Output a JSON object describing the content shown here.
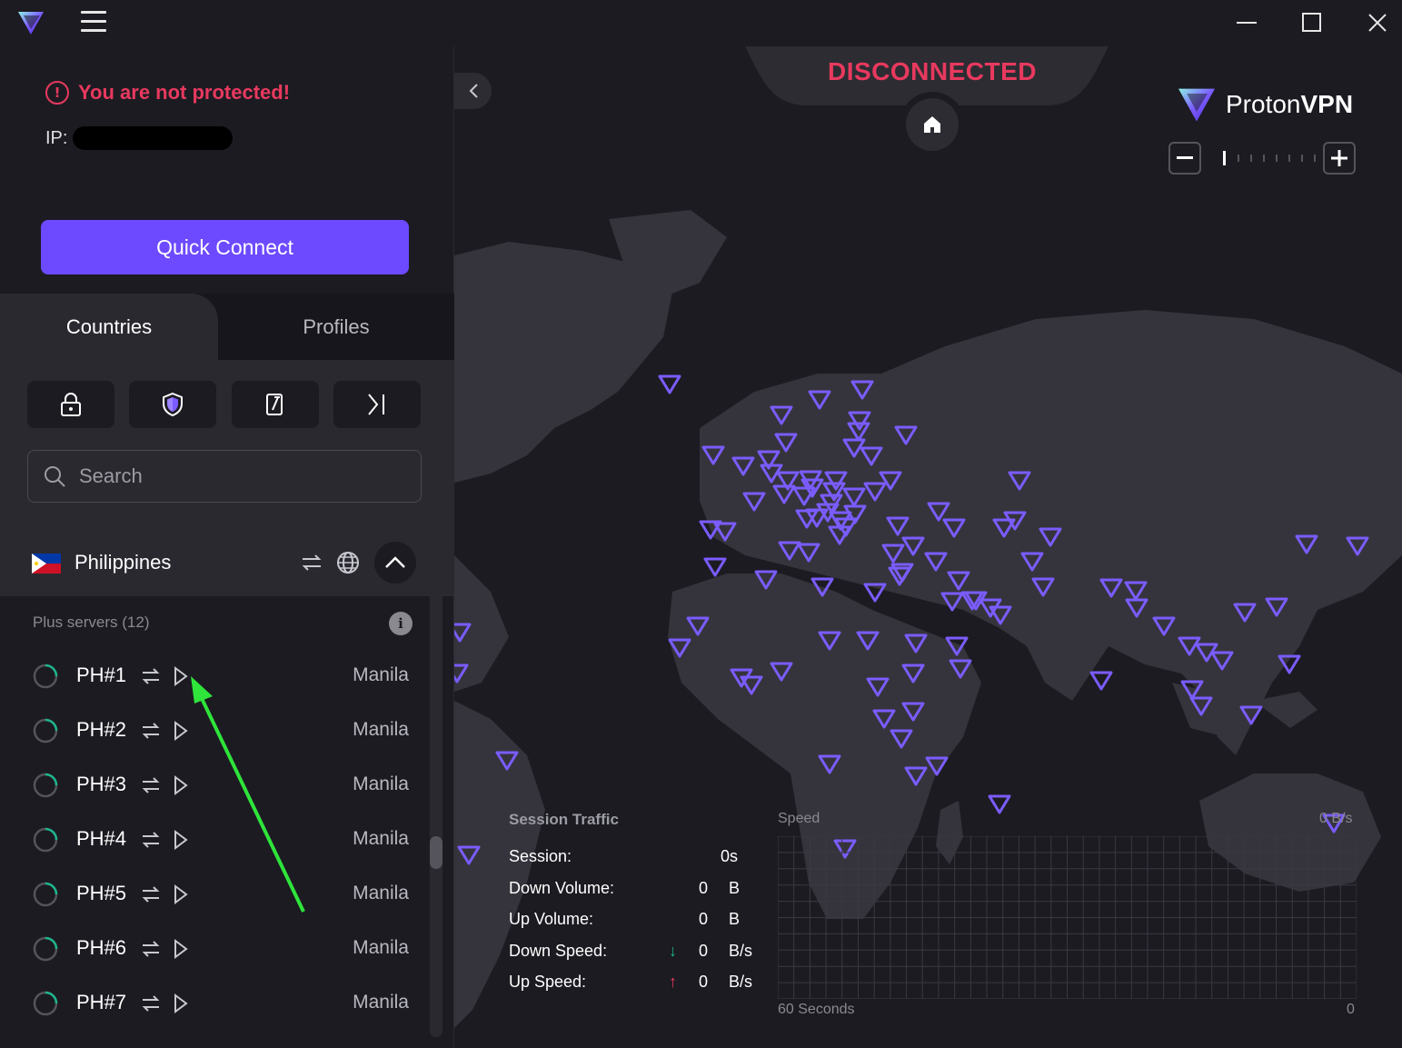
{
  "window": {
    "menu_icon": "hamburger-icon",
    "controls": [
      "minimize-icon",
      "maximize-icon",
      "close-icon"
    ]
  },
  "status": {
    "warning": "You are not protected!",
    "ip_label": "IP:",
    "connection": "DISCONNECTED"
  },
  "quick_connect": {
    "label": "Quick Connect",
    "color": "#6d4aff"
  },
  "tabs": [
    {
      "label": "Countries",
      "active": true
    },
    {
      "label": "Profiles",
      "active": false
    }
  ],
  "filters": [
    {
      "icon": "lock-icon"
    },
    {
      "icon": "shield-icon"
    },
    {
      "icon": "edit-icon"
    },
    {
      "icon": "arrow-right-bar-icon"
    }
  ],
  "search": {
    "placeholder": "Search"
  },
  "country": {
    "name": "Philippines",
    "expanded": true,
    "icons": [
      "p2p-icon",
      "globe-icon",
      "chevron-up-icon"
    ]
  },
  "plus_servers": {
    "label": "Plus servers (12)"
  },
  "servers": [
    {
      "name": "PH#1",
      "city": "Manila"
    },
    {
      "name": "PH#2",
      "city": "Manila"
    },
    {
      "name": "PH#3",
      "city": "Manila"
    },
    {
      "name": "PH#4",
      "city": "Manila"
    },
    {
      "name": "PH#5",
      "city": "Manila"
    },
    {
      "name": "PH#6",
      "city": "Manila"
    },
    {
      "name": "PH#7",
      "city": "Manila"
    }
  ],
  "brand": {
    "name_part1": "Proton",
    "name_part2": "VPN"
  },
  "traffic": {
    "title": "Session Traffic",
    "session_label": "Session:",
    "session_value": "0s",
    "down_volume_label": "Down Volume:",
    "down_volume_value": "0",
    "down_volume_unit": "B",
    "up_volume_label": "Up Volume:",
    "up_volume_value": "0",
    "up_volume_unit": "B",
    "down_speed_label": "Down Speed:",
    "down_speed_value": "0",
    "down_speed_unit": "B/s",
    "up_speed_label": "Up Speed:",
    "up_speed_value": "0",
    "up_speed_unit": "B/s",
    "down_arrow": "↓",
    "up_arrow": "↑"
  },
  "speed_chart": {
    "label": "Speed",
    "unit": "0 B/s",
    "x_left": "60 Seconds",
    "x_right": "0"
  },
  "colors": {
    "accent": "#6d4aff",
    "danger": "#e8395e",
    "server_pin": "#7b5cff",
    "load_ok": "#1db58d"
  }
}
